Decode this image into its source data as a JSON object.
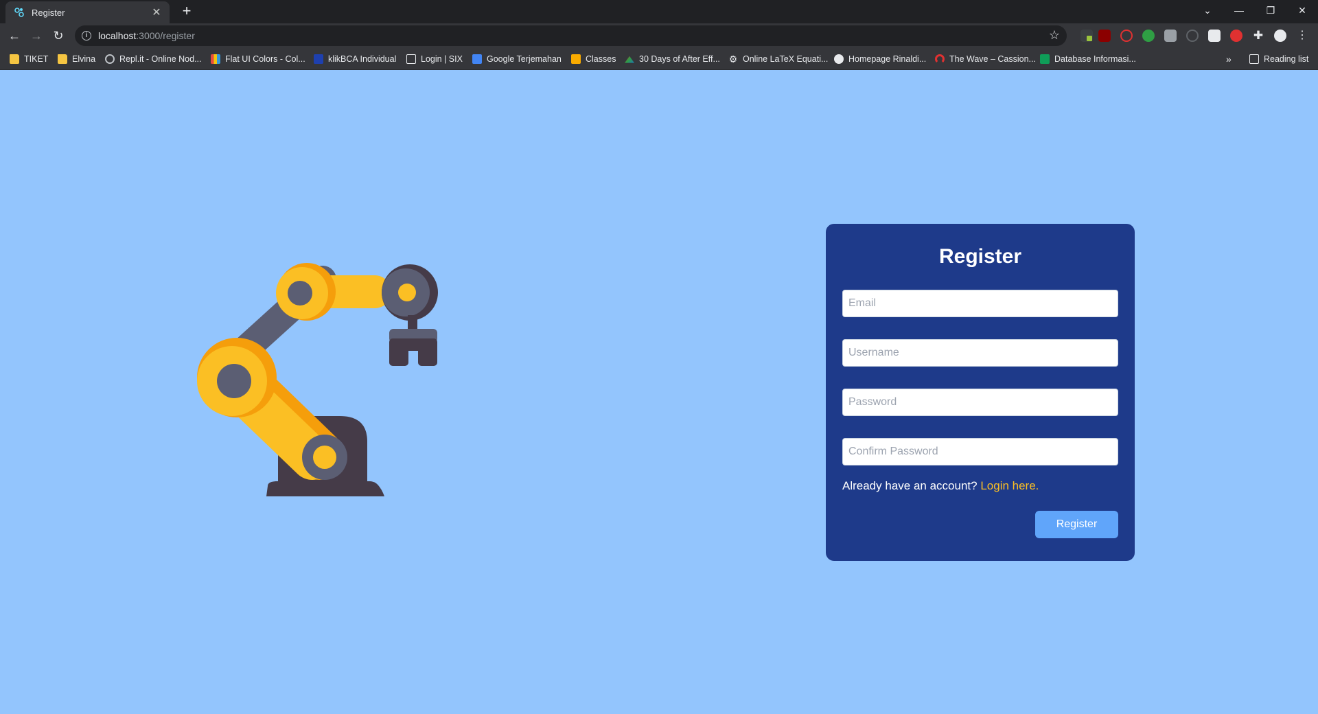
{
  "browser": {
    "tab_title": "Register",
    "url_host": "localhost",
    "url_path": ":3000/register",
    "reading_list": "Reading list",
    "bookmarks": [
      {
        "label": "TIKET",
        "icon": "folder-icon"
      },
      {
        "label": "Elvina",
        "icon": "folder-icon"
      },
      {
        "label": "Repl.it - Online Nod...",
        "icon": "replit-icon"
      },
      {
        "label": "Flat UI Colors - Col...",
        "icon": "flatui-icon"
      },
      {
        "label": "klikBCA Individual",
        "icon": "bca-icon"
      },
      {
        "label": "Login | SIX",
        "icon": "six-icon"
      },
      {
        "label": "Google Terjemahan",
        "icon": "translate-icon"
      },
      {
        "label": "Classes",
        "icon": "classroom-icon"
      },
      {
        "label": "30 Days of After Eff...",
        "icon": "ae-icon"
      },
      {
        "label": "Online LaTeX Equati...",
        "icon": "gear-icon"
      },
      {
        "label": "Homepage Rinaldi...",
        "icon": "globe-icon"
      },
      {
        "label": "The Wave – Cassion...",
        "icon": "wave-icon"
      },
      {
        "label": "Database Informasi...",
        "icon": "sheets-icon"
      }
    ]
  },
  "form": {
    "title": "Register",
    "email_placeholder": "Email",
    "username_placeholder": "Username",
    "password_placeholder": "Password",
    "confirm_placeholder": "Confirm Password",
    "switch_prompt": "Already have an account?",
    "switch_link": "Login here.",
    "submit_label": "Register"
  },
  "colors": {
    "page_bg": "#93c5fd",
    "card_bg": "#1e3a8a",
    "link": "#fbbf24",
    "button": "#60a5fa"
  }
}
